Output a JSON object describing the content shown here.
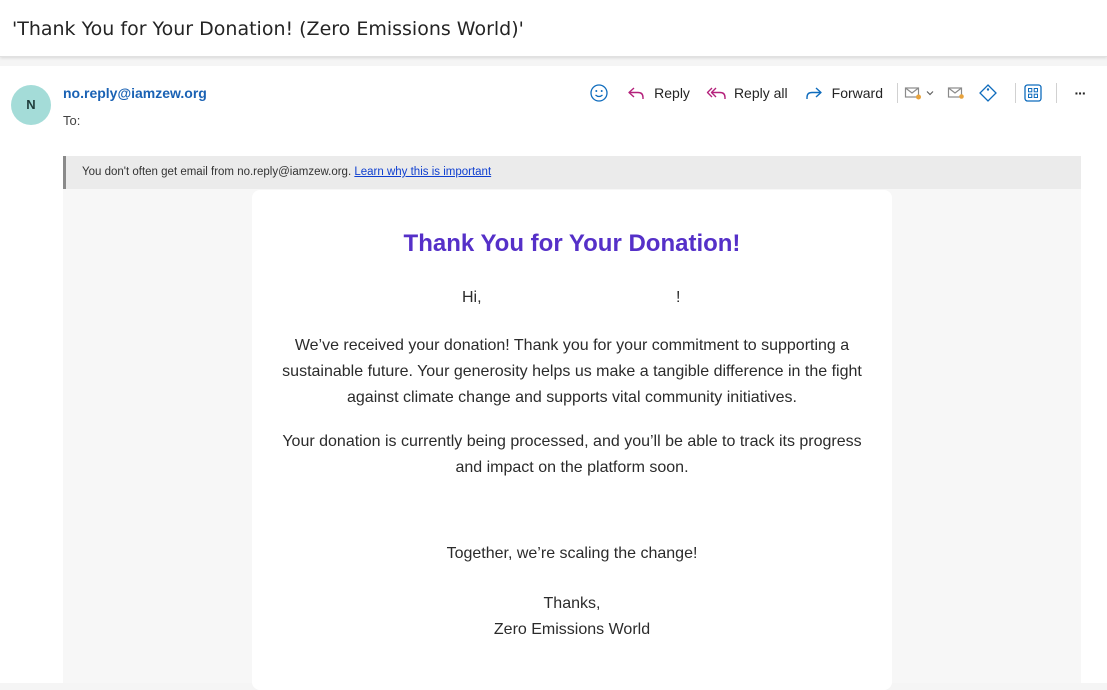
{
  "email": {
    "subject": "'Thank You for Your Donation! (Zero Emissions World)'",
    "avatar_initial": "N",
    "sender": "no.reply@iamzew.org",
    "to_label": "To:"
  },
  "toolbar": {
    "reply_label": "Reply",
    "reply_all_label": "Reply all",
    "forward_label": "Forward",
    "more_label": "···"
  },
  "notice": {
    "text": "You don't often get email from no.reply@iamzew.org.",
    "link": "Learn why this is important"
  },
  "message": {
    "heading": "Thank You for Your Donation!",
    "greeting": "Hi,",
    "greeting_end": "!",
    "paragraph1": "We’ve received your donation! Thank you for your commitment to supporting a sustainable future. Your generosity helps us make a tangible difference in the fight against climate change and supports vital community initiatives.",
    "paragraph2": "Your donation is currently being processed, and you’ll be able to track its progress and impact on the platform soon.",
    "closing": "Together, we’re scaling the change!",
    "signoff": "Thanks,",
    "signature": "Zero Emissions World"
  },
  "colors": {
    "heading": "#5530c8",
    "sender": "#1a62b4",
    "avatar_bg": "#a4dcd8",
    "accent_icon": "#0f6cbd"
  }
}
